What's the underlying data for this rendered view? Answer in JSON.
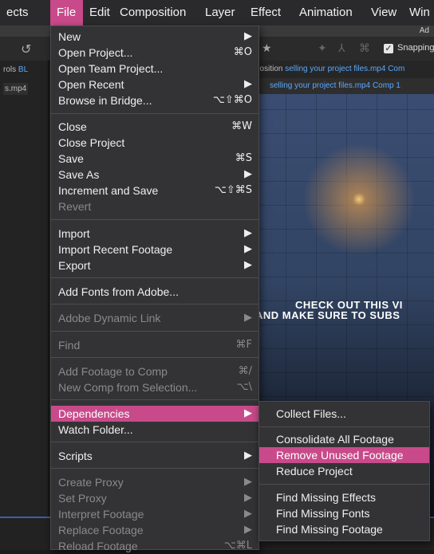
{
  "menubar": {
    "items": [
      {
        "label": "ects"
      },
      {
        "label": "File"
      },
      {
        "label": "Edit"
      },
      {
        "label": "Composition"
      },
      {
        "label": "Layer"
      },
      {
        "label": "Effect"
      },
      {
        "label": "Animation"
      },
      {
        "label": "View"
      },
      {
        "label": "Win"
      }
    ],
    "accent_color": "#c84a8a"
  },
  "background": {
    "title_fragment": "Ad",
    "snapping_label": "Snapping",
    "left_panel_text_1_prefix": "rols ",
    "left_panel_text_1_link": "BL",
    "left_panel_tab": "s.mp4",
    "comp_path_prefix": "position ",
    "comp_path_link": "selling your project files.mp4 Com",
    "comp_tab_label": "selling your project files.mp4 Comp 1",
    "overlay_line_1": "CHECK OUT THIS VI",
    "overlay_line_2": "AND MAKE SURE TO SUBS"
  },
  "file_menu": {
    "items": [
      {
        "label": "New",
        "shortcut": "▶",
        "enabled": true
      },
      {
        "label": "Open Project...",
        "shortcut": "⌘O",
        "enabled": true
      },
      {
        "label": "Open Team Project...",
        "shortcut": "",
        "enabled": true
      },
      {
        "label": "Open Recent",
        "shortcut": "▶",
        "enabled": true
      },
      {
        "label": "Browse in Bridge...",
        "shortcut": "⌥⇧⌘O",
        "enabled": true
      },
      {
        "label": "Close",
        "shortcut": "⌘W",
        "enabled": true
      },
      {
        "label": "Close Project",
        "shortcut": "",
        "enabled": true
      },
      {
        "label": "Save",
        "shortcut": "⌘S",
        "enabled": true
      },
      {
        "label": "Save As",
        "shortcut": "▶",
        "enabled": true
      },
      {
        "label": "Increment and Save",
        "shortcut": "⌥⇧⌘S",
        "enabled": true
      },
      {
        "label": "Revert",
        "shortcut": "",
        "enabled": false
      },
      {
        "label": "Import",
        "shortcut": "▶",
        "enabled": true
      },
      {
        "label": "Import Recent Footage",
        "shortcut": "▶",
        "enabled": true
      },
      {
        "label": "Export",
        "shortcut": "▶",
        "enabled": true
      },
      {
        "label": "Add Fonts from Adobe...",
        "shortcut": "",
        "enabled": true
      },
      {
        "label": "Adobe Dynamic Link",
        "shortcut": "▶",
        "enabled": false
      },
      {
        "label": "Find",
        "shortcut": "⌘F",
        "enabled": false
      },
      {
        "label": "Add Footage to Comp",
        "shortcut": "⌘/",
        "enabled": false
      },
      {
        "label": "New Comp from Selection...",
        "shortcut": "⌥\\",
        "enabled": false
      },
      {
        "label": "Dependencies",
        "shortcut": "▶",
        "enabled": true,
        "highlighted": true
      },
      {
        "label": "Watch Folder...",
        "shortcut": "",
        "enabled": true
      },
      {
        "label": "Scripts",
        "shortcut": "▶",
        "enabled": true
      },
      {
        "label": "Create Proxy",
        "shortcut": "▶",
        "enabled": false
      },
      {
        "label": "Set Proxy",
        "shortcut": "▶",
        "enabled": false
      },
      {
        "label": "Interpret Footage",
        "shortcut": "▶",
        "enabled": false
      },
      {
        "label": "Replace Footage",
        "shortcut": "▶",
        "enabled": false
      },
      {
        "label": "Reload Footage",
        "shortcut": "⌥⌘L",
        "enabled": false
      }
    ]
  },
  "dependencies_submenu": {
    "items": [
      {
        "label": "Collect Files..."
      },
      {
        "label": "Consolidate All Footage"
      },
      {
        "label": "Remove Unused Footage",
        "highlighted": true
      },
      {
        "label": "Reduce Project"
      },
      {
        "label": "Find Missing Effects"
      },
      {
        "label": "Find Missing Fonts"
      },
      {
        "label": "Find Missing Footage"
      }
    ]
  }
}
